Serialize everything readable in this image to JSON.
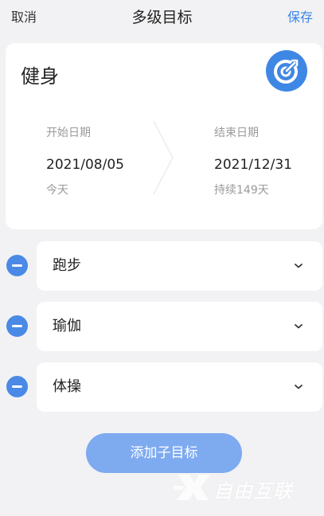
{
  "header": {
    "cancel_label": "取消",
    "title": "多级目标",
    "save_label": "保存"
  },
  "goal": {
    "title": "健身",
    "icon": "target-dart-icon",
    "start": {
      "label": "开始日期",
      "date": "2021/08/05",
      "note": "今天"
    },
    "end": {
      "label": "结束日期",
      "date": "2021/12/31",
      "note": "持续149天"
    }
  },
  "sub_goals": [
    {
      "label": "跑步"
    },
    {
      "label": "瑜伽"
    },
    {
      "label": "体操"
    }
  ],
  "add_button_label": "添加子目标",
  "watermark": {
    "text": "自由互联"
  },
  "colors": {
    "accent": "#3a86e8",
    "icon_blue": "#3f87e4",
    "button_blue": "#7eaaf0",
    "background": "#f2f2f4"
  }
}
